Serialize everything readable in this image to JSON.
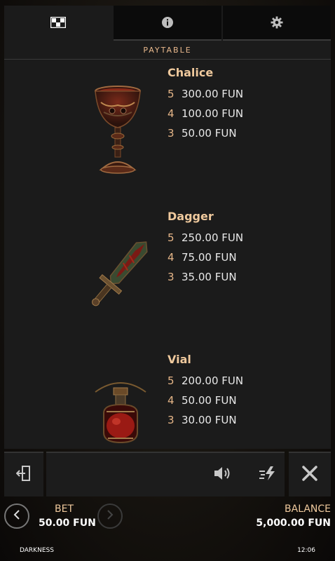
{
  "tabs": [
    {
      "icon": "paytable-grid-icon",
      "active": true
    },
    {
      "icon": "info-icon",
      "active": false
    },
    {
      "icon": "gear-icon",
      "active": false
    }
  ],
  "header": {
    "title": "PAYTABLE"
  },
  "symbols": [
    {
      "name": "Chalice",
      "icon": "chalice-icon",
      "payouts": [
        {
          "count": "5",
          "amount": "300.00 FUN"
        },
        {
          "count": "4",
          "amount": "100.00 FUN"
        },
        {
          "count": "3",
          "amount": "50.00 FUN"
        }
      ]
    },
    {
      "name": "Dagger",
      "icon": "dagger-icon",
      "payouts": [
        {
          "count": "5",
          "amount": "250.00 FUN"
        },
        {
          "count": "4",
          "amount": "75.00 FUN"
        },
        {
          "count": "3",
          "amount": "35.00 FUN"
        }
      ]
    },
    {
      "name": "Vial",
      "icon": "vial-icon",
      "payouts": [
        {
          "count": "5",
          "amount": "200.00 FUN"
        },
        {
          "count": "4",
          "amount": "50.00 FUN"
        },
        {
          "count": "3",
          "amount": "30.00 FUN"
        }
      ]
    }
  ],
  "toolbar": {
    "exit_icon": "exit-door-icon",
    "sound_icon": "speaker-icon",
    "turbo_icon": "turbo-bolt-icon",
    "close_icon": "close-icon"
  },
  "footer": {
    "bet_label": "BET",
    "bet_value": "50.00 FUN",
    "balance_label": "BALANCE",
    "balance_value": "5,000.00 FUN",
    "game_name": "DARKNESS",
    "clock": "12:06"
  },
  "colors": {
    "accent": "#efc99d",
    "panel": "#1b1b1b",
    "text": "#e8e8e8"
  }
}
